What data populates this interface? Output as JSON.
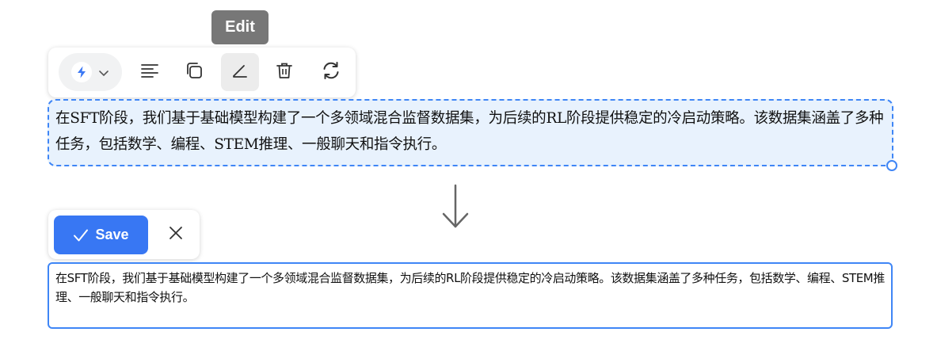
{
  "tooltip": {
    "label": "Edit"
  },
  "toolbar": {
    "model_icon": "bolt-icon",
    "items": [
      "align-left-icon",
      "copy-icon",
      "edit-icon",
      "trash-icon",
      "refresh-icon"
    ],
    "active_item": "edit-icon"
  },
  "message": {
    "text": "在SFT阶段，我们基于基础模型构建了一个多领域混合监督数据集，为后续的RL阶段提供稳定的冷启动策略。该数据集涵盖了多种任务，包括数学、编程、STEM推理、一般聊天和指令执行。"
  },
  "edit_bar": {
    "save_label": "Save",
    "close_icon": "close-icon"
  },
  "editor": {
    "value": "在SFT阶段，我们基于基础模型构建了一个多领域混合监督数据集，为后续的RL阶段提供稳定的冷启动策略。该数据集涵盖了多种任务，包括数学、编程、STEM推理、一般聊天和指令执行。"
  },
  "colors": {
    "accent": "#3877f3",
    "selection_bg": "#e8f2fd",
    "tooltip_bg": "#777777"
  }
}
